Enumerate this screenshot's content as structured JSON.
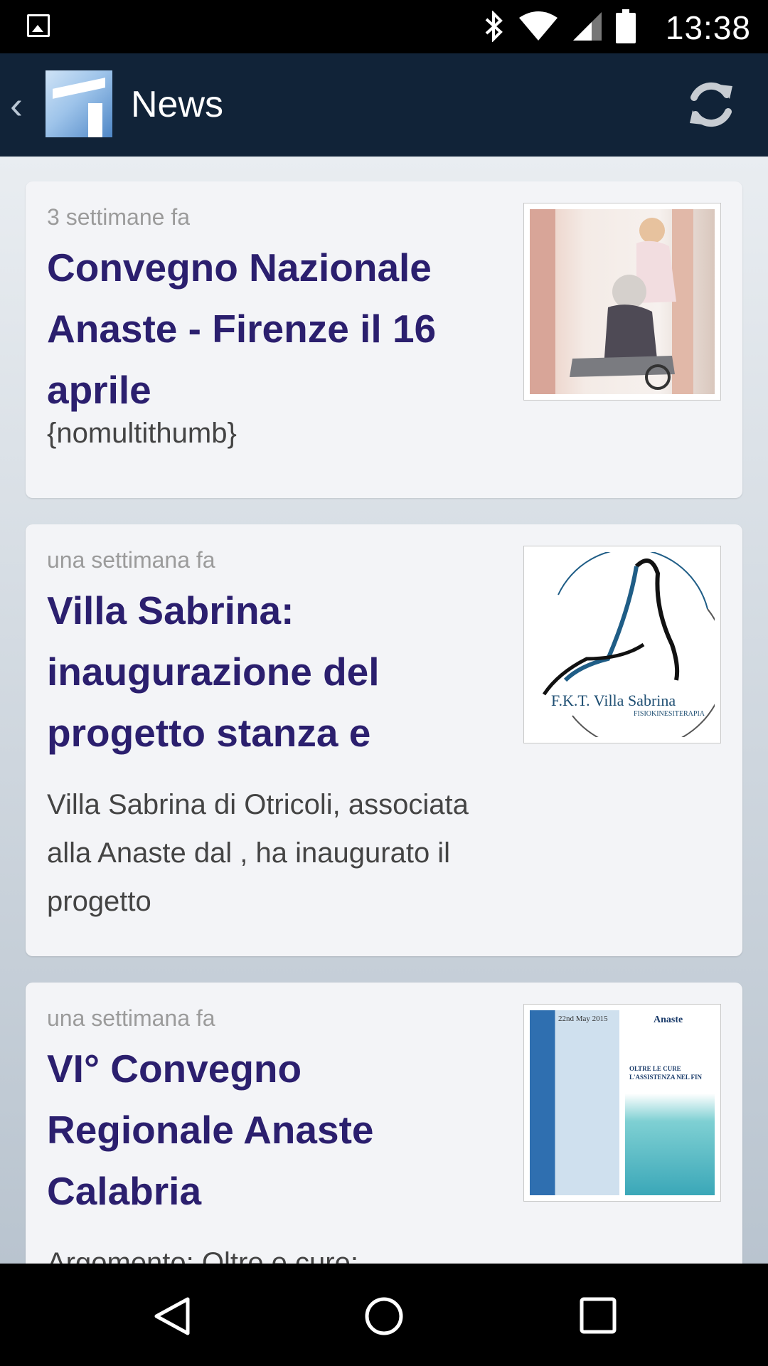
{
  "status_bar": {
    "time": "13:38",
    "icons": [
      "image-notification-icon",
      "bluetooth-icon",
      "wifi-icon",
      "signal-icon",
      "battery-icon"
    ]
  },
  "app_bar": {
    "title": "News",
    "icons": [
      "back-chevron-icon",
      "app-logo",
      "refresh-icon"
    ]
  },
  "news": [
    {
      "time": "3 settimane fa",
      "title": "Convegno Nazionale Anaste - Firenze il 16 aprile",
      "description": "{nomultithumb}"
    },
    {
      "time": "una settimana fa",
      "title": "Villa Sabrina: inaugurazione del progetto stanza e",
      "description": "Villa Sabrina di Otricoli, associata alla Anaste dal , ha inaugurato il progetto",
      "thumb_text": "F.K.T. Villa Sabrina",
      "thumb_subtext": "FISIOKINESITERAPIA"
    },
    {
      "time": "una settimana fa",
      "title": "VI° Convegno Regionale Anaste Calabria",
      "description": "Argomento: Oltre e cure:",
      "thumb_text": "22nd May 2015",
      "thumb_brand": "Anaste",
      "thumb_right_text": "OLTRE LE CURE L'ASSISTENZA NEL FIN"
    }
  ],
  "colors": {
    "app_bar": "#112338",
    "title_text": "#2b1f6e",
    "card_bg": "#f3f4f7"
  },
  "nav_bar": {
    "icons": [
      "back-triangle-icon",
      "home-circle-icon",
      "recents-square-icon"
    ]
  }
}
